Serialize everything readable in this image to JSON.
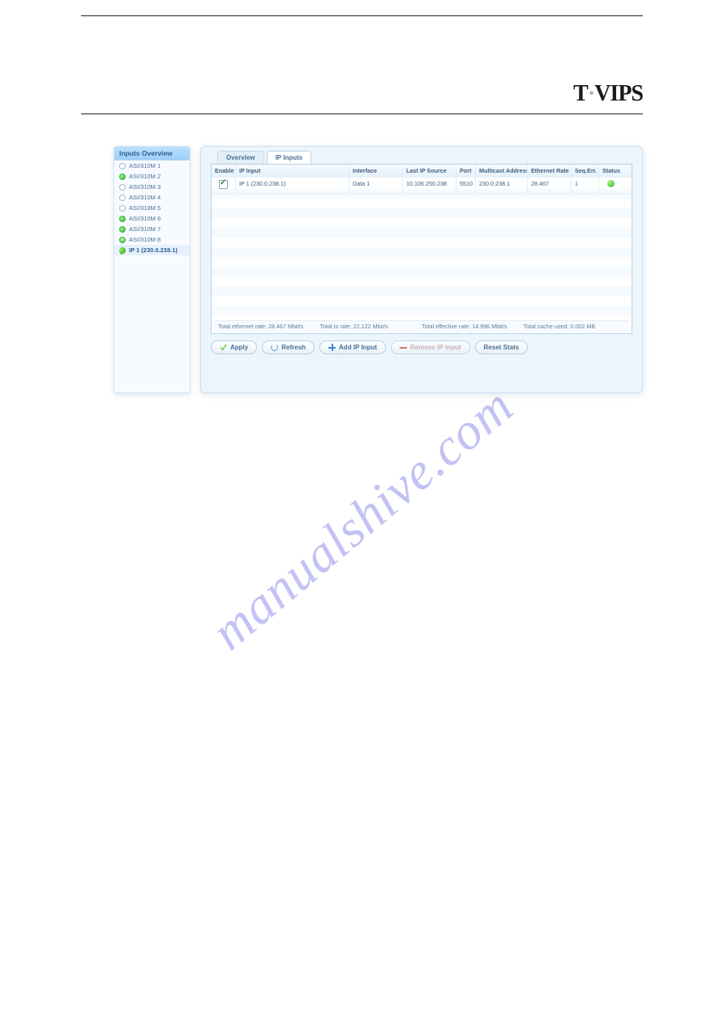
{
  "brand": "T·VIPS",
  "watermark": "manualshive.com",
  "sidebar": {
    "title": "Inputs Overview",
    "items": [
      {
        "label": "ASI/310M 1",
        "status": "empty"
      },
      {
        "label": "ASI/310M 2",
        "status": "green"
      },
      {
        "label": "ASI/310M 3",
        "status": "empty"
      },
      {
        "label": "ASI/310M 4",
        "status": "empty"
      },
      {
        "label": "ASI/310M 5",
        "status": "empty"
      },
      {
        "label": "ASI/310M 6",
        "status": "green"
      },
      {
        "label": "ASI/310M 7",
        "status": "green"
      },
      {
        "label": "ASI/310M 8",
        "status": "green-x"
      },
      {
        "label": "IP 1 (230.0.238.1)",
        "status": "leaf",
        "selected": true
      }
    ]
  },
  "tabs": {
    "items": [
      {
        "label": "Overview",
        "active": false
      },
      {
        "label": "IP Inputs",
        "active": true
      }
    ]
  },
  "table": {
    "headers": {
      "enable": "Enable",
      "ip_input": "IP Input",
      "interface": "Interface",
      "last_ip_source": "Last IP Source",
      "port": "Port",
      "multicast_address": "Multicast Address",
      "ethernet_rate": "Ethernet Rate [Mbit/s]",
      "seq_err": "Seq.Err.",
      "status": "Status"
    },
    "rows": [
      {
        "enable": true,
        "ip_input": "IP 1 (230.0.238.1)",
        "interface": "Data 1",
        "last_ip_source": "10.106.250.238",
        "port": "5510",
        "multicast_address": "230.0.238.1",
        "ethernet_rate": "28.467",
        "seq_err": "1",
        "status": "ok"
      }
    ],
    "totals": {
      "eth": "Total ethernet rate: 28.467 Mbit/s",
      "ts": "Total ts rate: 22.122 Mbit/s",
      "eff": "Total effective rate: 14.996 Mbit/s",
      "cache": "Total cache used: 0.002 MB"
    }
  },
  "buttons": {
    "apply": "Apply",
    "refresh": "Refresh",
    "add_ip": "Add IP Input",
    "remove_ip": "Remove IP Input",
    "reset_stats": "Reset Stats"
  }
}
